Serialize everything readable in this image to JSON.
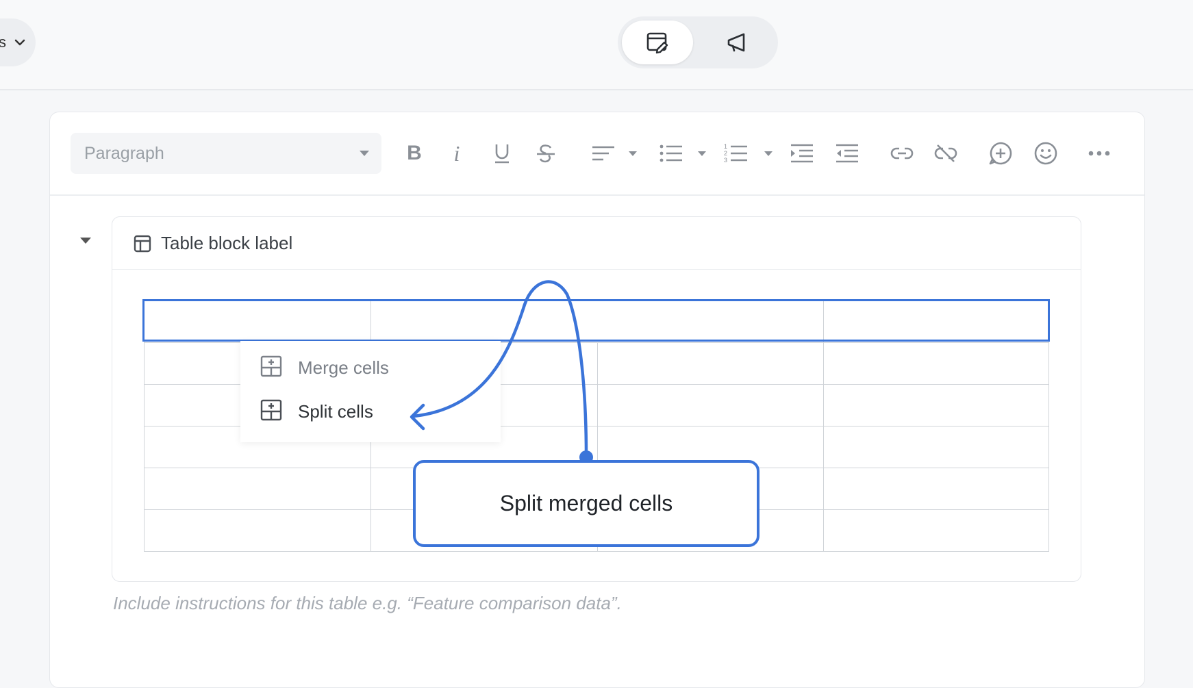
{
  "topbar": {
    "left_dropdown_partial": "s",
    "modes": [
      {
        "name": "edit",
        "icon": "edit-document-icon",
        "active": true
      },
      {
        "name": "announce",
        "icon": "megaphone-icon",
        "active": false
      }
    ]
  },
  "toolbar": {
    "style_select_value": "Paragraph",
    "buttons": [
      "bold-icon",
      "italic-icon",
      "underline-icon",
      "strikethrough-icon",
      "align-icon",
      "bullet-list-icon",
      "numbered-list-icon",
      "indent-icon",
      "outdent-icon",
      "link-icon",
      "unlink-icon",
      "add-comment-icon",
      "emoji-icon",
      "more-icon"
    ]
  },
  "table_block": {
    "label": "Table block label",
    "rows": 6,
    "cols": 4
  },
  "context_menu": {
    "merge_label": "Merge cells",
    "split_label": "Split cells"
  },
  "callout": {
    "text": "Split merged cells",
    "accent_color": "#3b74d9"
  },
  "hint_text": "Include instructions for this table e.g. “Feature comparison data”."
}
